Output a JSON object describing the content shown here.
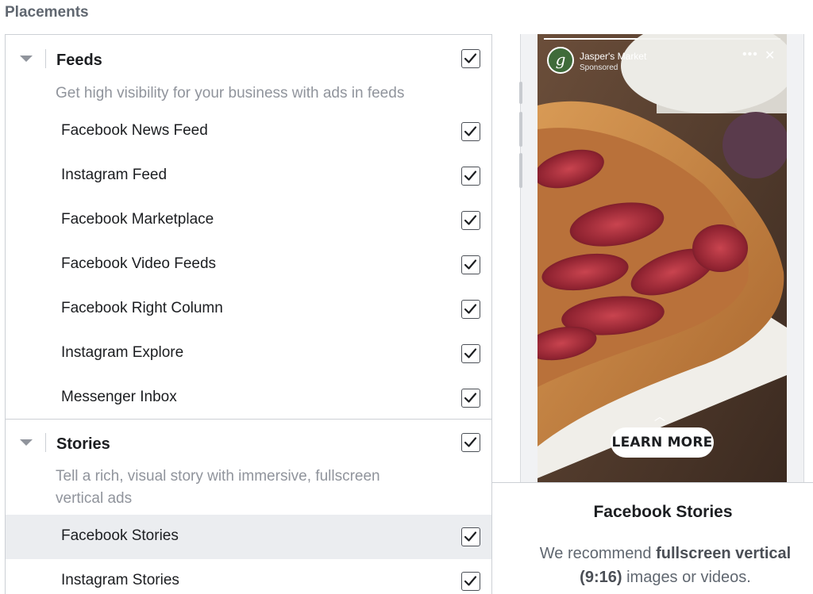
{
  "heading": "Placements",
  "groups": [
    {
      "title": "Feeds",
      "description": "Get high visibility for your business with ads in feeds",
      "checked": true,
      "items": [
        {
          "label": "Facebook News Feed",
          "checked": true
        },
        {
          "label": "Instagram Feed",
          "checked": true
        },
        {
          "label": "Facebook Marketplace",
          "checked": true
        },
        {
          "label": "Facebook Video Feeds",
          "checked": true
        },
        {
          "label": "Facebook Right Column",
          "checked": true
        },
        {
          "label": "Instagram Explore",
          "checked": true
        },
        {
          "label": "Messenger Inbox",
          "checked": true
        }
      ]
    },
    {
      "title": "Stories",
      "description": "Tell a rich, visual story with immersive, fullscreen vertical ads",
      "checked": true,
      "items": [
        {
          "label": "Facebook Stories",
          "checked": true,
          "selected": true
        },
        {
          "label": "Instagram Stories",
          "checked": true
        }
      ]
    }
  ],
  "preview": {
    "brand_initial": "g",
    "brand_name": "Jasper's Market",
    "sponsored": "Sponsored",
    "more_icon": "•••",
    "close_icon": "✕",
    "chevron": "︿",
    "cta": "LEARN MORE",
    "story_progress": 0.4
  },
  "info": {
    "title": "Facebook Stories",
    "desc_pre": "We recommend ",
    "desc_bold1": "fullscreen vertical",
    "desc_bold2": "(9:16)",
    "desc_post": " images or videos."
  },
  "colors": {
    "check": "#1c1e21",
    "selected_row": "#ebedf0",
    "muted_text": "#90949c"
  }
}
